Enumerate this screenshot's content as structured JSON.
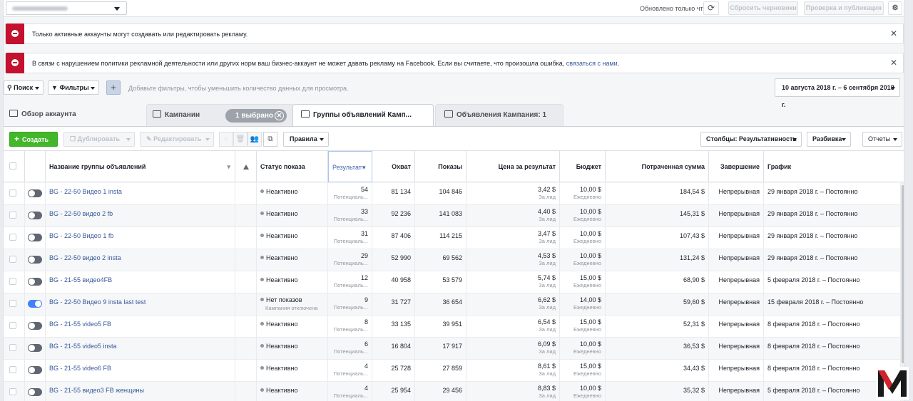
{
  "topbar": {
    "updated_text": "Обновлено только что",
    "discard_label": "Сбросить черновики",
    "publish_label": "Проверка и публикация"
  },
  "alerts": [
    {
      "text": "Только активные аккаунты могут создавать или редактировать рекламу."
    },
    {
      "text": "В связи с нарушением политики рекламной деятельности или других норм ваш бизнес-аккаунт не может давать рекламу на Facebook. Если вы считаете, что произошла ошибка,",
      "link": "связаться с нами",
      "end": "."
    }
  ],
  "filterbar": {
    "search_label": "Поиск",
    "filters_label": "Фильтры",
    "hint": "Добавьте фильтры, чтобы уменьшить количество данных для просмотра.",
    "date_range": "10 августа 2018 г. – 6 сентября 2018 г."
  },
  "tabs": {
    "overview": "Обзор аккаунта",
    "campaigns": "Кампании",
    "selected_pill": "1 выбрано",
    "adsets": "Группы объявлений Камп...",
    "ads": "Объявления Кампания: 1"
  },
  "toolbar": {
    "create": "Создать",
    "duplicate": "Дублировать",
    "edit": "Редактировать",
    "rules": "Правила",
    "columns": "Столбцы: Результативность",
    "breakdown": "Разбивка",
    "reports": "Отчеты"
  },
  "columns": {
    "name": "Название группы объявлений",
    "status": "Статус показа",
    "results": "Результаты",
    "reach": "Охват",
    "impressions": "Показы",
    "cost": "Цена за результат",
    "budget": "Бюджет",
    "spent": "Потраченная сумма",
    "end": "Завершение",
    "schedule": "График"
  },
  "rows": [
    {
      "on": false,
      "name": "BG - 22-50 Видео 1 insta",
      "status": "Неактивно",
      "status_sub": "",
      "results": "54",
      "results_sub": "Потенциаль...",
      "reach": "81 134",
      "impressions": "104 846",
      "cost": "3,42 $",
      "cost_sub": "За лид",
      "budget": "10,00 $",
      "budget_sub": "Ежедневно",
      "spent": "184,54 $",
      "end": "Непрерывная",
      "schedule": "29 января 2018 г. – Постоянно"
    },
    {
      "on": false,
      "name": "BG - 22-50 видео 2 fb",
      "status": "Неактивно",
      "status_sub": "",
      "results": "33",
      "results_sub": "Потенциаль...",
      "reach": "92 236",
      "impressions": "141 083",
      "cost": "4,40 $",
      "cost_sub": "За лид",
      "budget": "10,00 $",
      "budget_sub": "Ежедневно",
      "spent": "145,31 $",
      "end": "Непрерывная",
      "schedule": "29 января 2018 г. – Постоянно"
    },
    {
      "on": false,
      "name": "BG - 22-50 Видео 1 fb",
      "status": "Неактивно",
      "status_sub": "",
      "results": "31",
      "results_sub": "Потенциаль...",
      "reach": "87 406",
      "impressions": "114 215",
      "cost": "3,47 $",
      "cost_sub": "За лид",
      "budget": "10,00 $",
      "budget_sub": "Ежедневно",
      "spent": "107,43 $",
      "end": "Непрерывная",
      "schedule": "29 января 2018 г. – Постоянно"
    },
    {
      "on": false,
      "name": "BG - 22-50 видео 2 insta",
      "status": "Неактивно",
      "status_sub": "",
      "results": "29",
      "results_sub": "Потенциаль...",
      "reach": "52 990",
      "impressions": "69 562",
      "cost": "4,53 $",
      "cost_sub": "За лид",
      "budget": "10,00 $",
      "budget_sub": "Ежедневно",
      "spent": "131,24 $",
      "end": "Непрерывная",
      "schedule": "29 января 2018 г. – Постоянно"
    },
    {
      "on": false,
      "name": "BG - 21-55 видео4FB",
      "status": "Неактивно",
      "status_sub": "",
      "results": "12",
      "results_sub": "Потенциаль...",
      "reach": "40 958",
      "impressions": "53 579",
      "cost": "5,74 $",
      "cost_sub": "За лид",
      "budget": "15,00 $",
      "budget_sub": "Ежедневно",
      "spent": "68,90 $",
      "end": "Непрерывная",
      "schedule": "5 февраля 2018 г. – Постоянно"
    },
    {
      "on": true,
      "name": "BG - 22-50 Видео 9 insta last test",
      "status": "Нет показов",
      "status_sub": "Кампания отключена",
      "results": "9",
      "results_sub": "Потенциаль...",
      "reach": "31 727",
      "impressions": "36 654",
      "cost": "6,62 $",
      "cost_sub": "За лид",
      "budget": "14,00 $",
      "budget_sub": "Ежедневно",
      "spent": "59,60 $",
      "end": "Непрерывная",
      "schedule": "15 февраля 2018 г. – Постоянно"
    },
    {
      "on": false,
      "name": "BG - 21-55 video5 FB",
      "status": "Неактивно",
      "status_sub": "",
      "results": "8",
      "results_sub": "Потенциаль...",
      "reach": "33 135",
      "impressions": "39 951",
      "cost": "6,54 $",
      "cost_sub": "За лид",
      "budget": "15,00 $",
      "budget_sub": "Ежедневно",
      "spent": "52,31 $",
      "end": "Непрерывная",
      "schedule": "8 февраля 2018 г. – Постоянно"
    },
    {
      "on": false,
      "name": "BG - 21-55 video5 insta",
      "status": "Неактивно",
      "status_sub": "",
      "results": "6",
      "results_sub": "Потенциаль...",
      "reach": "16 804",
      "impressions": "17 917",
      "cost": "6,09 $",
      "cost_sub": "За лид",
      "budget": "10,00 $",
      "budget_sub": "Ежедневно",
      "spent": "36,53 $",
      "end": "Непрерывная",
      "schedule": "8 февраля 2018 г. – Постоянно"
    },
    {
      "on": false,
      "name": "BG - 21-55 video6 FB",
      "status": "Неактивно",
      "status_sub": "",
      "results": "4",
      "results_sub": "Потенциаль...",
      "reach": "25 728",
      "impressions": "27 859",
      "cost": "8,61 $",
      "cost_sub": "За лид",
      "budget": "15,00 $",
      "budget_sub": "Ежедневно",
      "spent": "34,43 $",
      "end": "Непрерывная",
      "schedule": "8 февраля 2018 г. – Постоянно"
    },
    {
      "on": false,
      "name": "BG - 21-55 видео3 FB женщины",
      "status": "Неактивно",
      "status_sub": "",
      "results": "4",
      "results_sub": "Потенциаль...",
      "reach": "25 954",
      "impressions": "29 456",
      "cost": "8,83 $",
      "cost_sub": "За лид",
      "budget": "10,00 $",
      "budget_sub": "Ежедневно",
      "spent": "35,32 $",
      "end": "Непрерывная",
      "schedule": "5 февраля 2018 г. – Постоянно"
    }
  ],
  "colors": {
    "alert_red": "#c4112f",
    "create_green": "#42b72a",
    "link_blue": "#365899",
    "toggle_on": "#4080ff"
  },
  "watermark": "M"
}
